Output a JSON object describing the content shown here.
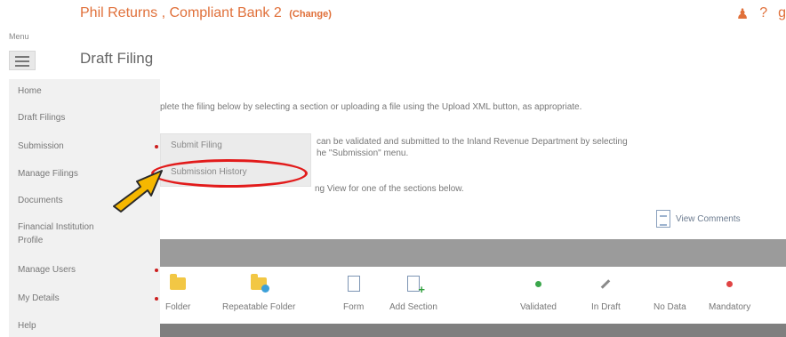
{
  "header": {
    "title": "Phil Returns , Compliant Bank 2",
    "change_label": "(Change)",
    "icons": [
      "user-icon",
      "help-icon",
      "g"
    ]
  },
  "menu_label": "Menu",
  "page_title": "Draft Filing",
  "sidebar": {
    "items": [
      {
        "label": "Home",
        "has_submenu": false
      },
      {
        "label": "Draft Filings",
        "has_submenu": false
      },
      {
        "label": "Submission",
        "has_submenu": true
      },
      {
        "label": "Manage Filings",
        "has_submenu": false
      },
      {
        "label": "Documents",
        "has_submenu": false
      },
      {
        "label": "Financial Institution",
        "has_submenu": false
      },
      {
        "label": "Profile",
        "has_submenu": false
      },
      {
        "label": "Manage Users",
        "has_submenu": true
      },
      {
        "label": "My Details",
        "has_submenu": true
      },
      {
        "label": "Help",
        "has_submenu": false
      }
    ]
  },
  "submenu": {
    "items": [
      {
        "label": "Submit Filing"
      },
      {
        "label": "Submission History"
      }
    ]
  },
  "instructions": {
    "line1": "plete the filing below by selecting a section or uploading a file using the Upload XML button, as appropriate.",
    "line2a": "can be validated and submitted to the Inland Revenue Department by selecting",
    "line2b": "he \"Submission\" menu.",
    "line3": "ng View for one of the sections below."
  },
  "view_comments_label": "View Comments",
  "legend": [
    {
      "label": "Folder",
      "icon": "folder-icon"
    },
    {
      "label": "Repeatable Folder",
      "icon": "repeatable-folder-icon"
    },
    {
      "label": "Form",
      "icon": "form-icon"
    },
    {
      "label": "Add Section",
      "icon": "add-section-icon"
    },
    {
      "label": "Validated",
      "icon": "green-dot-icon"
    },
    {
      "label": "In Draft",
      "icon": "pencil-icon"
    },
    {
      "label": "No Data",
      "icon": "blank-icon"
    },
    {
      "label": "Mandatory",
      "icon": "red-dot-icon"
    }
  ],
  "colors": {
    "accent": "#e0703a",
    "highlight": "#e21b1b",
    "arrow": "#f5b700",
    "required_dot": "#cc1f1f"
  }
}
